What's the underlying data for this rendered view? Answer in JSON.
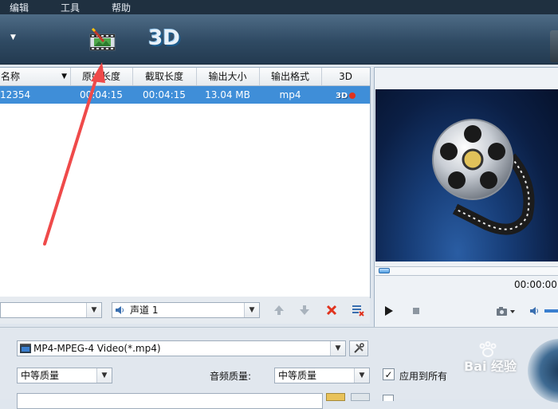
{
  "menu": {
    "items": [
      "编辑",
      "工具",
      "帮助"
    ]
  },
  "toolbar": {
    "dropdown_arrow": "▼",
    "three_d_label": "3D"
  },
  "table": {
    "columns": [
      "名称",
      "原始长度",
      "截取长度",
      "输出大小",
      "输出格式",
      "3D"
    ],
    "row": {
      "name": "12354",
      "original_length": "00:04:15",
      "clip_length": "00:04:15",
      "output_size": "13.04 MB",
      "output_format": "mp4",
      "three_d_badge": "3D"
    }
  },
  "list_controls": {
    "audio_track": "声道 1"
  },
  "player": {
    "time": "00:00:00"
  },
  "output": {
    "profile": "MP4-MPEG-4 Video(*.mp4)",
    "video_quality": "中等质量",
    "audio_quality_label": "音频质量:",
    "audio_quality": "中等质量",
    "apply_all_label": "应用到所有"
  },
  "watermark": {
    "text": "Bai 经验"
  },
  "colors": {
    "selection": "#3f8ed8",
    "toolbar": "#2f4a63",
    "annotation_arrow": "#ef4a4a",
    "delete_red": "#e0331e"
  }
}
